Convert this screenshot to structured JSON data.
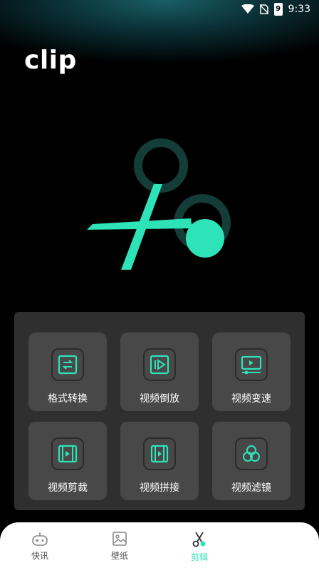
{
  "status": {
    "time": "9:33",
    "battery_label": "9"
  },
  "app": {
    "title": "clip"
  },
  "colors": {
    "accent": "#2ee3b8",
    "panel": "#2f2f2f",
    "tile": "#484848",
    "nav_text": "#555555"
  },
  "tools": [
    {
      "label": "格式转换",
      "icon": "convert-icon"
    },
    {
      "label": "视频倒放",
      "icon": "reverse-play-icon"
    },
    {
      "label": "视频变速",
      "icon": "speed-icon"
    },
    {
      "label": "视频剪裁",
      "icon": "film-crop-icon"
    },
    {
      "label": "视频拼接",
      "icon": "splice-icon"
    },
    {
      "label": "视频滤镜",
      "icon": "filter-icon"
    }
  ],
  "nav": [
    {
      "label": "快讯",
      "icon": "gamepad-icon",
      "active": false
    },
    {
      "label": "壁纸",
      "icon": "image-icon",
      "active": false
    },
    {
      "label": "剪辑",
      "icon": "scissors-icon",
      "active": true
    }
  ]
}
